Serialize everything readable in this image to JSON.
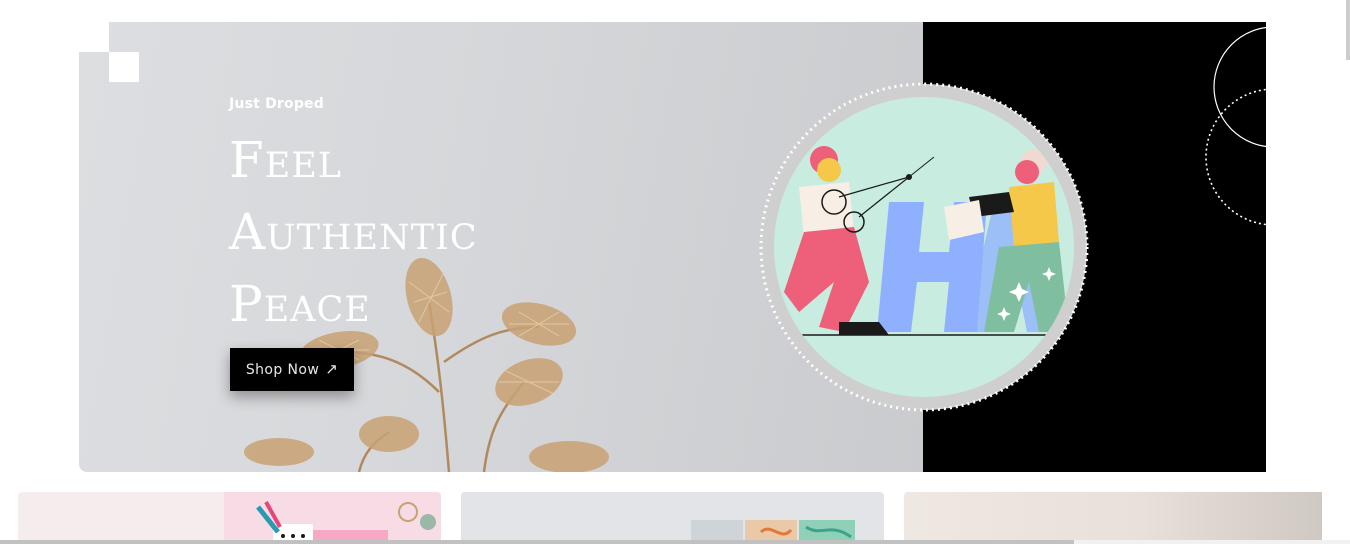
{
  "hero": {
    "eyebrow": "Just Droped",
    "headline_lines": [
      "Feel",
      "Authentic",
      "Peace"
    ],
    "cta_label": "Shop Now",
    "cta_icon": "arrow-up-right-icon",
    "cta_arrow": "↗",
    "colors": {
      "panel": "#d6d8db",
      "dark_panel": "#000000",
      "button": "#000000",
      "text": "#ffffff",
      "illustration_circle": "#c8ece0",
      "figure_pink": "#ee5f7a",
      "figure_yellow": "#f5c84a",
      "letter_blue": "#8fb0ff",
      "figure_green": "#7fbf9f"
    }
  },
  "illustration": {
    "icon": "two-people-building-letters-illustration"
  },
  "cards": [
    {
      "name": "card-stationery",
      "icon": "stationery-image"
    },
    {
      "name": "card-marble",
      "icon": "marble-art-image"
    },
    {
      "name": "card-neutral",
      "icon": "neutral-backdrop-image"
    }
  ]
}
